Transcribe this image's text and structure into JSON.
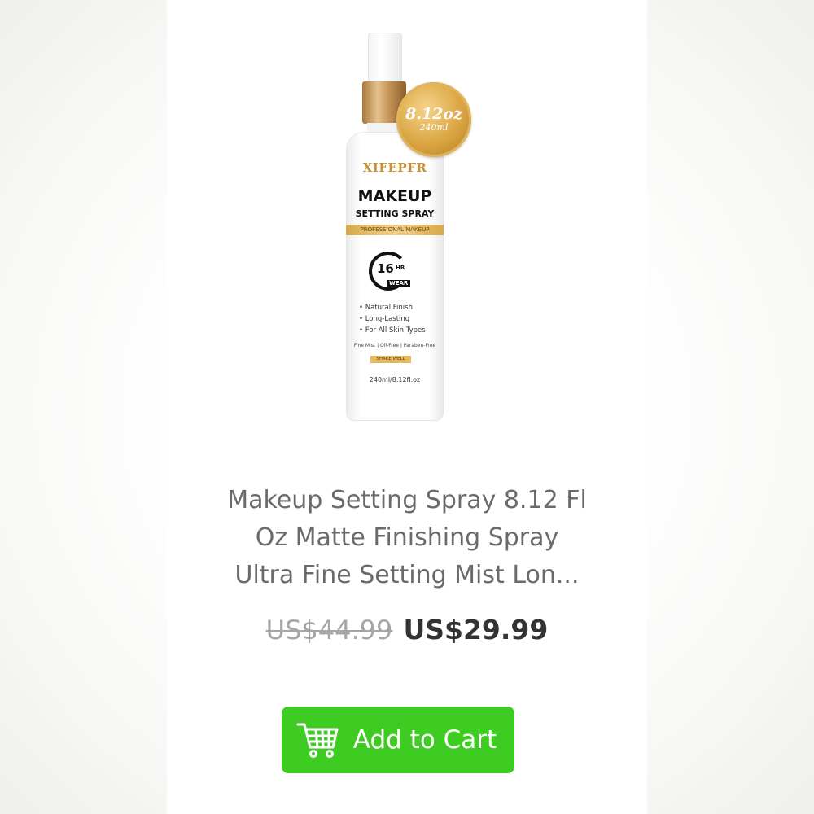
{
  "product": {
    "image": {
      "seal_oz": "8.12oz",
      "seal_ml": "240ml",
      "brand": "XIFEPFR",
      "label_title": "MAKEUP",
      "label_subtitle": "SETTING SPRAY",
      "label_band": "PROFESSIONAL MAKEUP",
      "wear_hours": "16",
      "wear_hr": "HR",
      "wear_word": "WEAR",
      "features": [
        "• Natural Finish",
        "• Long-Lasting",
        "• For All Skin Types"
      ],
      "claims": "Fine Mist | Oil-Free | Paraben-Free",
      "shake": "SHAKE WELL",
      "volume": "240ml/8.12fl.oz"
    },
    "title_lines": [
      "Makeup Setting Spray 8.12 Fl",
      "Oz Matte Finishing Spray",
      "Ultra Fine Setting Mist Lon..."
    ],
    "original_price": "US$44.99",
    "sale_price": "US$29.99"
  },
  "cart_button": {
    "label": "Add to Cart",
    "icon": "shopping-cart-icon",
    "color": "#3fcc22"
  }
}
